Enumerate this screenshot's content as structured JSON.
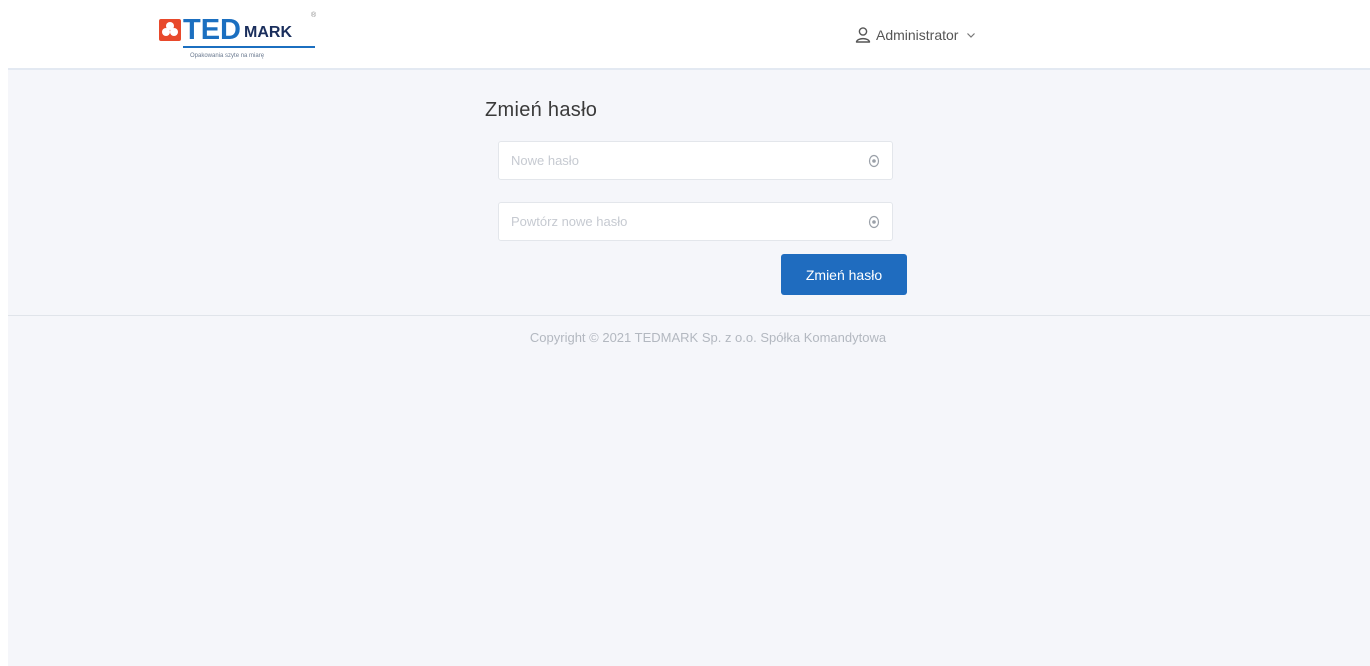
{
  "header": {
    "logo": {
      "brand_primary": "TED",
      "brand_secondary": "MARK",
      "registered": "®",
      "tagline": "Opakowania szyte na miarę"
    },
    "user_menu": {
      "icon": "user-icon",
      "label": "Administrator",
      "dropdown_icon": "chevron-down-icon"
    }
  },
  "main": {
    "title": "Zmień hasło",
    "fields": [
      {
        "placeholder": "Nowe hasło",
        "value": "",
        "icon": "eye-icon"
      },
      {
        "placeholder": "Powtórz nowe hasło",
        "value": "",
        "icon": "eye-icon"
      }
    ],
    "submit_label": "Zmień hasło"
  },
  "footer": {
    "copyright": "Copyright © 2021 TEDMARK Sp. z o.o. Spółka Komandytowa"
  },
  "colors": {
    "accent": "#1f6cbf",
    "brand_blue": "#1b6fc0",
    "brand_red": "#e8492b",
    "background": "#f5f6fa"
  }
}
